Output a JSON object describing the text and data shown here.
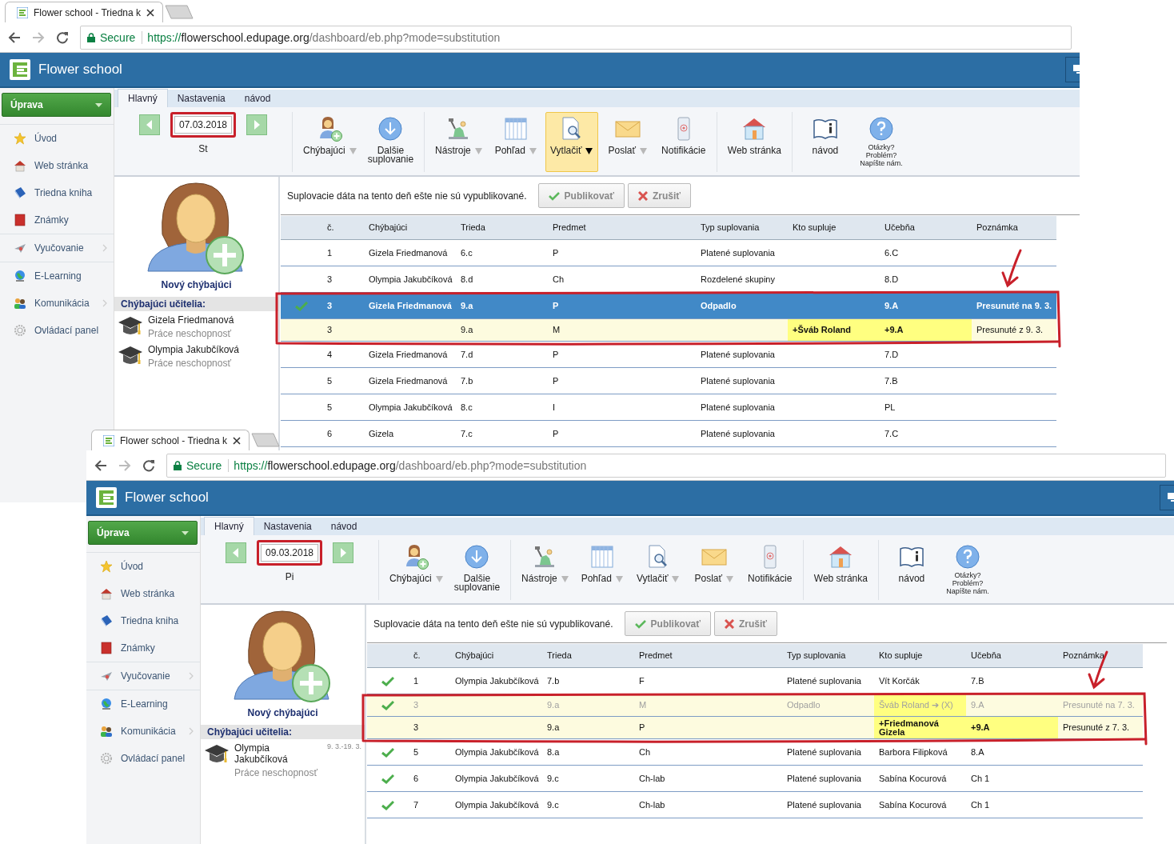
{
  "windows": [
    {
      "tab_title": "Flower school - Triedna k",
      "security": "Secure",
      "url_scheme": "https://",
      "url_host": "flowerschool.edupage.org",
      "url_path": "/dashboard/eb.php?mode=substitution",
      "app_title": "Flower school",
      "sidebar": {
        "button": "Úprava",
        "groups": [
          [
            {
              "label": "Úvod",
              "submenu": false
            },
            {
              "label": "Web stránka",
              "submenu": false
            },
            {
              "label": "Triedna kniha",
              "submenu": false
            },
            {
              "label": "Známky",
              "submenu": false
            }
          ],
          [
            {
              "label": "Vyučovanie",
              "submenu": true
            }
          ],
          [
            {
              "label": "E-Learning",
              "submenu": false
            },
            {
              "label": "Komunikácia",
              "submenu": true
            },
            {
              "label": "Ovládací panel",
              "submenu": false
            }
          ]
        ]
      },
      "ribbon_tabs": [
        {
          "label": "Hlavný",
          "selected": true
        },
        {
          "label": "Nastavenia",
          "selected": false
        },
        {
          "label": "návod",
          "selected": false
        }
      ],
      "date_nav": {
        "date": "07.03.2018",
        "day": "St",
        "framed": true
      },
      "toolbar_groups": [
        [
          {
            "kind": "button",
            "label": "Chýbajúci",
            "dropdown": true,
            "selected": false
          },
          {
            "kind": "button",
            "label": "Dalšie\nsuplovanie",
            "dropdown": false,
            "selected": false
          }
        ],
        [
          {
            "kind": "button",
            "label": "Nástroje",
            "dropdown": true,
            "selected": false
          },
          {
            "kind": "button",
            "label": "Pohľad",
            "dropdown": true,
            "selected": false
          },
          {
            "kind": "button",
            "label": "Vytlačiť",
            "dropdown": true,
            "selected": true
          },
          {
            "kind": "button",
            "label": "Poslať",
            "dropdown": true,
            "selected": false
          },
          {
            "kind": "button",
            "label": "Notifikácie",
            "dropdown": false,
            "selected": false
          }
        ],
        [
          {
            "kind": "button",
            "label": "Web stránka",
            "dropdown": false,
            "selected": false
          }
        ],
        [
          {
            "kind": "button",
            "label": "návod",
            "dropdown": false,
            "selected": false
          },
          {
            "kind": "note",
            "label": "Otázky?\nProblém?\nNapíšte nám.",
            "dropdown": false,
            "selected": false
          }
        ]
      ],
      "new_absent": "Nový chýbajúci",
      "absent_header": "Chýbajúci učitelia:",
      "absent_teachers": [
        {
          "name": "Gizela Friedmanová",
          "reason": "Práce neschopnosť"
        },
        {
          "name": "Olympia Jakubčíková",
          "reason": "Práce neschopnosť"
        }
      ],
      "notice": "Suplovacie dáta na tento deň ešte nie sú vypublikované.",
      "actions": [
        {
          "kind": "confirm",
          "label": "Publikovať"
        },
        {
          "kind": "cancel",
          "label": "Zrušiť"
        }
      ],
      "table": {
        "columns": [
          "č.",
          "Chýbajúci",
          "Trieda",
          "Predmet",
          "Typ suplovania",
          "Kto supluje",
          "Učebňa",
          "Poznámka"
        ],
        "rows": [
          {
            "kind": "normal",
            "checked": false,
            "selected": false,
            "framed": false,
            "substitute_marked": false,
            "room_marked": false,
            "cells": {
              "no": "1",
              "absent": "Gizela Friedmanová",
              "class": "6.c",
              "subject": "P",
              "type": "Platené suplovania",
              "room": "6.C"
            }
          },
          {
            "kind": "normal",
            "checked": false,
            "selected": false,
            "framed": false,
            "substitute_marked": false,
            "room_marked": false,
            "cells": {
              "no": "3",
              "absent": "Olympia Jakubčíková",
              "class": "8.d",
              "subject": "Ch",
              "type": "Rozdelené skupiny",
              "room": "8.D"
            }
          },
          {
            "kind": "normal",
            "checked": true,
            "selected": true,
            "framed": true,
            "substitute_marked": false,
            "room_marked": false,
            "cells": {
              "no": "3",
              "absent": "Gizela Friedmanová",
              "class": "9.a",
              "subject": "P",
              "type": "Odpadlo",
              "room": "9.A",
              "note": "Presunuté na 9. 3."
            }
          },
          {
            "kind": "moved",
            "checked": false,
            "selected": false,
            "framed": true,
            "substitute_marked": true,
            "room_marked": true,
            "cells": {
              "no": "3",
              "class": "9.a",
              "subject": "M",
              "substitute": "+Šváb Roland",
              "room": "+9.A",
              "note": "Presunuté z 9. 3."
            }
          },
          {
            "kind": "normal",
            "checked": false,
            "selected": false,
            "framed": false,
            "substitute_marked": false,
            "room_marked": false,
            "cells": {
              "no": "4",
              "absent": "Gizela Friedmanová",
              "class": "7.d",
              "subject": "P",
              "type": "Platené suplovania",
              "room": "7.D"
            }
          },
          {
            "kind": "normal",
            "checked": false,
            "selected": false,
            "framed": false,
            "substitute_marked": false,
            "room_marked": false,
            "cells": {
              "no": "5",
              "absent": "Gizela Friedmanová",
              "class": "7.b",
              "subject": "P",
              "type": "Platené suplovania",
              "room": "7.B"
            }
          },
          {
            "kind": "normal",
            "checked": false,
            "selected": false,
            "framed": false,
            "substitute_marked": false,
            "room_marked": false,
            "cells": {
              "no": "5",
              "absent": "Olympia Jakubčíková",
              "class": "8.c",
              "subject": "I",
              "type": "Platené suplovania",
              "room": "PL"
            }
          },
          {
            "kind": "normal",
            "checked": false,
            "selected": false,
            "framed": false,
            "substitute_marked": false,
            "room_marked": false,
            "cells": {
              "no": "6",
              "absent": "Gizela",
              "class": "7.c",
              "subject": "P",
              "type": "Platené suplovania",
              "room": "7.C"
            }
          }
        ]
      }
    },
    {
      "tab_title": "Flower school - Triedna k",
      "security": "Secure",
      "url_scheme": "https://",
      "url_host": "flowerschool.edupage.org",
      "url_path": "/dashboard/eb.php?mode=substitution",
      "app_title": "Flower school",
      "sidebar": {
        "button": "Úprava",
        "groups": [
          [
            {
              "label": "Úvod",
              "submenu": false
            },
            {
              "label": "Web stránka",
              "submenu": false
            },
            {
              "label": "Triedna kniha",
              "submenu": false
            },
            {
              "label": "Známky",
              "submenu": false
            }
          ],
          [
            {
              "label": "Vyučovanie",
              "submenu": true
            }
          ],
          [
            {
              "label": "E-Learning",
              "submenu": false
            },
            {
              "label": "Komunikácia",
              "submenu": true
            },
            {
              "label": "Ovládací panel",
              "submenu": false
            }
          ]
        ]
      },
      "ribbon_tabs": [
        {
          "label": "Hlavný",
          "selected": true
        },
        {
          "label": "Nastavenia",
          "selected": false
        },
        {
          "label": "návod",
          "selected": false
        }
      ],
      "date_nav": {
        "date": "09.03.2018",
        "day": "Pi",
        "framed": true
      },
      "toolbar_groups": [
        [
          {
            "kind": "button",
            "label": "Chýbajúci",
            "dropdown": true,
            "selected": false
          },
          {
            "kind": "button",
            "label": "Dalšie\nsuplovanie",
            "dropdown": false,
            "selected": false
          }
        ],
        [
          {
            "kind": "button",
            "label": "Nástroje",
            "dropdown": true,
            "selected": false
          },
          {
            "kind": "button",
            "label": "Pohľad",
            "dropdown": true,
            "selected": false
          },
          {
            "kind": "button",
            "label": "Vytlačiť",
            "dropdown": true,
            "selected": false
          },
          {
            "kind": "button",
            "label": "Poslať",
            "dropdown": true,
            "selected": false
          },
          {
            "kind": "button",
            "label": "Notifikácie",
            "dropdown": false,
            "selected": false
          }
        ],
        [
          {
            "kind": "button",
            "label": "Web stránka",
            "dropdown": false,
            "selected": false
          }
        ],
        [
          {
            "kind": "button",
            "label": "návod",
            "dropdown": false,
            "selected": false
          },
          {
            "kind": "note",
            "label": "Otázky?\nProblém?\nNapíšte nám.",
            "dropdown": false,
            "selected": false
          }
        ]
      ],
      "new_absent": "Nový chýbajúci",
      "absent_header": "Chýbajúci učitelia:",
      "absent_teachers": [
        {
          "name": "Olympia Jakubčíková",
          "reason": "Práce neschopnosť",
          "dates": "9. 3.-19. 3."
        }
      ],
      "notice": "Suplovacie dáta na tento deň ešte nie sú vypublikované.",
      "actions": [
        {
          "kind": "confirm",
          "label": "Publikovať"
        },
        {
          "kind": "cancel",
          "label": "Zrušiť"
        }
      ],
      "table": {
        "columns": [
          "č.",
          "Chýbajúci",
          "Trieda",
          "Predmet",
          "Typ suplovania",
          "Kto supluje",
          "Učebňa",
          "Poznámka"
        ],
        "rows": [
          {
            "kind": "normal",
            "checked": true,
            "selected": false,
            "framed": false,
            "substitute_marked": false,
            "room_marked": false,
            "cells": {
              "no": "1",
              "absent": "Olympia Jakubčíková",
              "class": "7.b",
              "subject": "F",
              "type": "Platené suplovania",
              "substitute": "Vít Korčák",
              "room": "7.B"
            }
          },
          {
            "kind": "cancelled",
            "checked": true,
            "selected": false,
            "framed": true,
            "substitute_marked": true,
            "room_marked": false,
            "cells": {
              "no": "3",
              "class": "9.a",
              "subject": "M",
              "type": "Odpadlo",
              "substitute": "Šváb Roland ➔ (X)",
              "room": "9.A",
              "note": "Presunuté na 7. 3."
            }
          },
          {
            "kind": "moved",
            "checked": false,
            "selected": false,
            "framed": true,
            "substitute_marked": true,
            "room_marked": true,
            "cells": {
              "no": "3",
              "class": "9.a",
              "subject": "P",
              "substitute": "+Friedmanová Gizela",
              "room": "+9.A",
              "note": "Presunuté z 7. 3."
            }
          },
          {
            "kind": "normal",
            "checked": true,
            "selected": false,
            "framed": false,
            "substitute_marked": false,
            "room_marked": false,
            "cells": {
              "no": "5",
              "absent": "Olympia Jakubčíková",
              "class": "8.a",
              "subject": "Ch",
              "type": "Platené suplovania",
              "substitute": "Barbora Filipková",
              "room": "8.A"
            }
          },
          {
            "kind": "normal",
            "checked": true,
            "selected": false,
            "framed": false,
            "substitute_marked": false,
            "room_marked": false,
            "cells": {
              "no": "6",
              "absent": "Olympia Jakubčíková",
              "class": "9.c",
              "subject": "Ch-lab",
              "type": "Platené suplovania",
              "substitute": "Sabína Kocurová",
              "room": "Ch 1"
            }
          },
          {
            "kind": "normal",
            "checked": true,
            "selected": false,
            "framed": false,
            "substitute_marked": false,
            "room_marked": false,
            "cells": {
              "no": "7",
              "absent": "Olympia Jakubčíková",
              "class": "9.c",
              "subject": "Ch-lab",
              "type": "Platené suplovania",
              "substitute": "Sabína Kocurová",
              "room": "Ch 1"
            }
          }
        ]
      }
    }
  ]
}
